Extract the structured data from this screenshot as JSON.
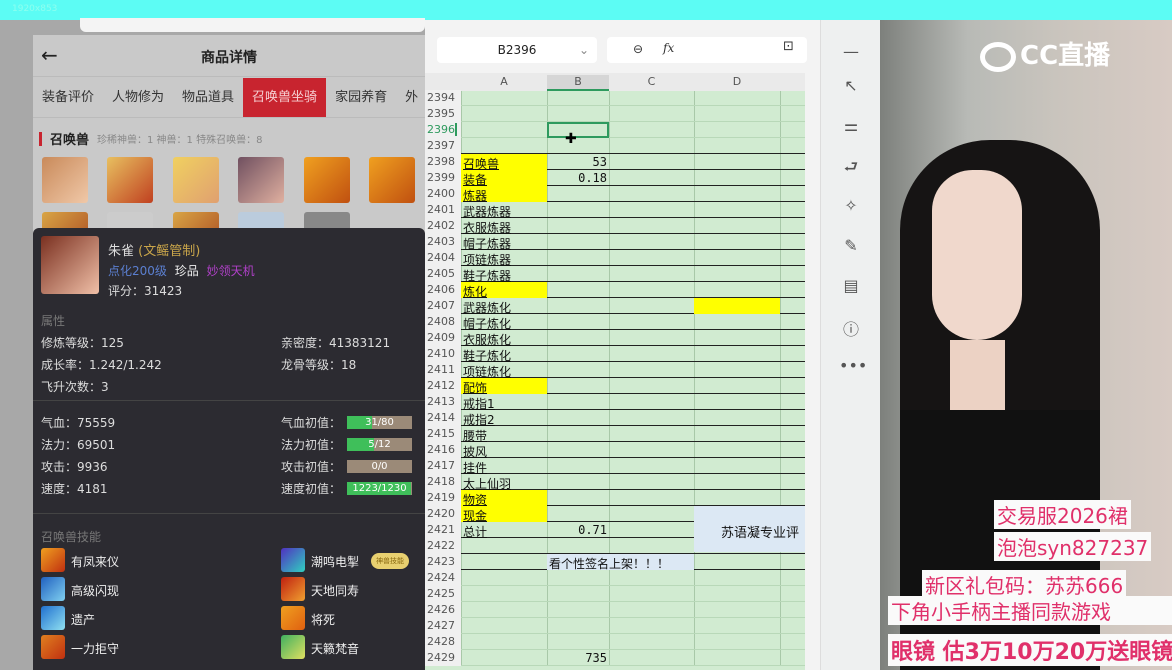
{
  "topbar": {
    "label": "1920x853"
  },
  "phone": {
    "title": "商品详情",
    "back": "←",
    "tabs": [
      "装备评价",
      "人物修为",
      "物品道具",
      "召唤兽坐骑",
      "家园养育",
      "外"
    ],
    "active_tab": 3,
    "section": {
      "title": "召唤兽",
      "counts": "珍稀神兽：1   神兽：1   特殊召唤兽：8"
    },
    "pet": {
      "name": "朱雀",
      "tag": "(文鳐管制)",
      "level": "点化200级",
      "rank": "珍品",
      "trait": "妙领天机",
      "score": "评分：31423",
      "attr_title": "属性",
      "attrs": [
        "修炼等级：125",
        "亲密度：41383121",
        "成长率：1.242/1.242",
        "龙骨等级：18",
        "飞升次数：3"
      ],
      "stats": [
        "气血：75559",
        "法力：69501",
        "攻击：9936",
        "速度：4181"
      ],
      "inits": [
        {
          "label": "气血初值：",
          "value": "31/80",
          "fill": 0.39
        },
        {
          "label": "法力初值：",
          "value": "5/12",
          "fill": 0.42
        },
        {
          "label": "攻击初值：",
          "value": "0/0",
          "fill": 0
        },
        {
          "label": "速度初值：",
          "value": "1223/1230",
          "fill": 0.99
        }
      ],
      "skills_title": "召唤兽技能",
      "skills": [
        "有凤来仪",
        "潮鸣电掣",
        "高级闪现",
        "天地同寿",
        "遗产",
        "将死",
        "一力拒守",
        "天籁梵音"
      ],
      "skill_badge": "神兽技能"
    }
  },
  "sheet": {
    "namebox": "B2396",
    "fx": "fx",
    "columns": [
      "A",
      "B",
      "C",
      "D"
    ],
    "rows": [
      {
        "n": "2394"
      },
      {
        "n": "2395"
      },
      {
        "n": "2396"
      },
      {
        "n": "2397"
      },
      {
        "n": "2398",
        "a": "召唤兽",
        "y": true,
        "b": "53"
      },
      {
        "n": "2399",
        "a": "装备",
        "y": true,
        "b": "0.18"
      },
      {
        "n": "2400",
        "a": "炼器",
        "y": true
      },
      {
        "n": "2401",
        "a": "武器炼器"
      },
      {
        "n": "2402",
        "a": "衣服炼器"
      },
      {
        "n": "2403",
        "a": "帽子炼器"
      },
      {
        "n": "2404",
        "a": "项链炼器"
      },
      {
        "n": "2405",
        "a": "鞋子炼器"
      },
      {
        "n": "2406",
        "a": "炼化",
        "y": true
      },
      {
        "n": "2407",
        "a": "武器炼化"
      },
      {
        "n": "2408",
        "a": "帽子炼化"
      },
      {
        "n": "2409",
        "a": "衣服炼化"
      },
      {
        "n": "2410",
        "a": "鞋子炼化"
      },
      {
        "n": "2411",
        "a": "项链炼化"
      },
      {
        "n": "2412",
        "a": "配饰",
        "y": true
      },
      {
        "n": "2413",
        "a": "戒指1"
      },
      {
        "n": "2414",
        "a": "戒指2"
      },
      {
        "n": "2415",
        "a": "腰带"
      },
      {
        "n": "2416",
        "a": "披风"
      },
      {
        "n": "2417",
        "a": "挂件"
      },
      {
        "n": "2418",
        "a": "太上仙羽"
      },
      {
        "n": "2419",
        "a": "物资",
        "y": true
      },
      {
        "n": "2420",
        "a": "现金",
        "y": true
      },
      {
        "n": "2421",
        "a": "总计",
        "b": "0.71"
      },
      {
        "n": "2422"
      },
      {
        "n": "2423"
      },
      {
        "n": "2424"
      },
      {
        "n": "2425"
      },
      {
        "n": "2426"
      },
      {
        "n": "2427"
      },
      {
        "n": "2428"
      },
      {
        "n": "2429",
        "b": "735"
      }
    ],
    "merged_note": "看个性签名上架！！！",
    "side_note": "苏语凝专业评"
  },
  "stream": {
    "logo": "CC直播",
    "overlays": [
      "交易服2026裙",
      "泡泡syn827237",
      "新区礼包码：苏苏666",
      "下角小手柄主播同款游戏",
      "眼镜  估3万10万20万送眼镜"
    ]
  }
}
